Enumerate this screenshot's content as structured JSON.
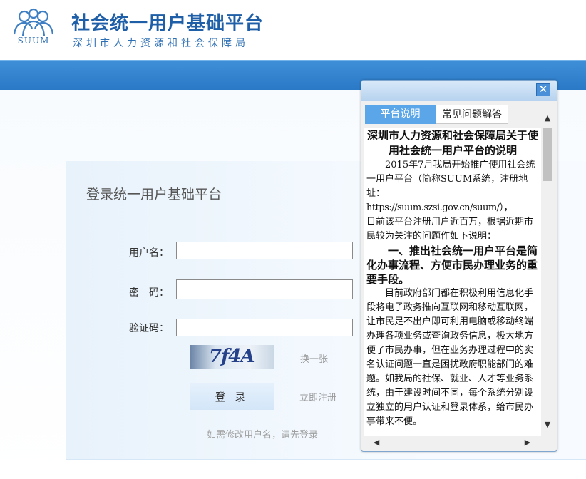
{
  "header": {
    "logo_text": "SUUM",
    "title": "社会统一用户基础平台",
    "subtitle": "深圳市人力资源和社会保障局"
  },
  "login": {
    "title": "登录统一用户基础平台",
    "username_label": "用户名：",
    "password_label": "密　码：",
    "captcha_label": "验证码：",
    "captcha_text": "7f4A",
    "refresh_captcha": "换一张",
    "login_button": "登 录",
    "register_link": "立即注册",
    "hint": "如需修改用户名，请先登录"
  },
  "popup": {
    "close": "✕",
    "tabs": [
      "平台说明",
      "常见问题解答"
    ],
    "doc_title": "深圳市人力资源和社会保障局关于使用社会统一用户平台的说明",
    "p1": "2015年7月我局开始推广使用社会统一用户平台（简称SUUM系统，注册地址：",
    "url": "https://suum.szsi.gov.cn/suum/），",
    "p1b": "目前该平台注册用户近百万，根据近期市民较为关注的问题作如下说明：",
    "section1": "一、推出社会统一用户平台是简化办事流程、方便市民办理业务的重要手段。",
    "p2": "目前政府部门都在积极利用信息化手段将电子政务推向互联网和移动互联网，让市民足不出户即可利用电脑或移动终端办理各项业务或查询政务信息，极大地方便了市民办事，但在业务办理过程中的实名认证问题一直是困扰政府职能部门的难题。如我局的社保、就业、人才等业务系统，由于建设时间不同，每个系统分别设立独立的用户认证和登录体系，给市民办事带来不便。"
  }
}
